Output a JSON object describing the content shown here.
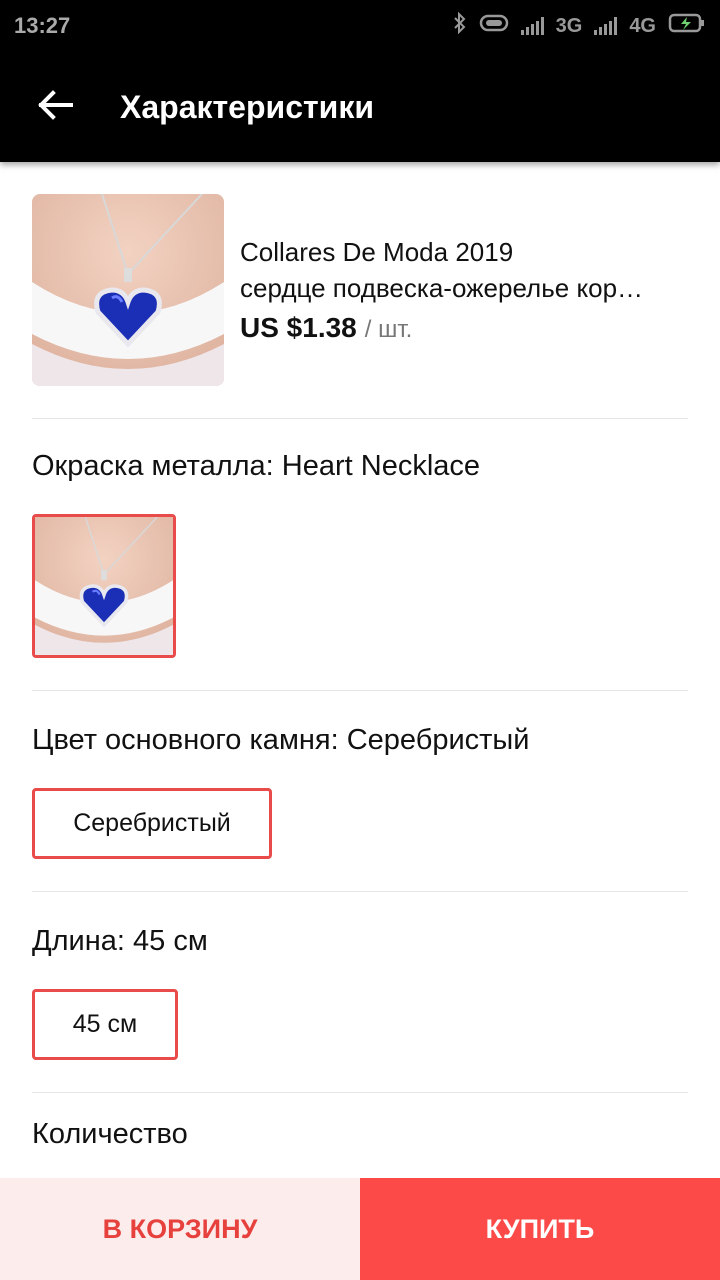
{
  "status_bar": {
    "time": "13:27",
    "net1": "3G",
    "net2": "4G"
  },
  "toolbar": {
    "title": "Характеристики",
    "back_icon": "arrow-left-icon"
  },
  "product": {
    "name_line1": "Collares De Moda 2019",
    "name_line2": "сердце подвеска-ожерелье кор…",
    "price": "US $1.38",
    "unit": "/ шт."
  },
  "options": {
    "metal": {
      "label": "Окраска металла: Heart Necklace"
    },
    "stone": {
      "label": "Цвет основного камня: Серебристый",
      "chip": "Серебристый"
    },
    "length": {
      "label": "Длина: 45 см",
      "chip": "45 см"
    },
    "quantity": {
      "label": "Количество"
    }
  },
  "actions": {
    "cart": "В КОРЗИНУ",
    "buy": "КУПИТЬ"
  },
  "colors": {
    "accent": "#fb4a47",
    "accent_light": "#fdecec",
    "border_selected": "#e94b4b"
  }
}
